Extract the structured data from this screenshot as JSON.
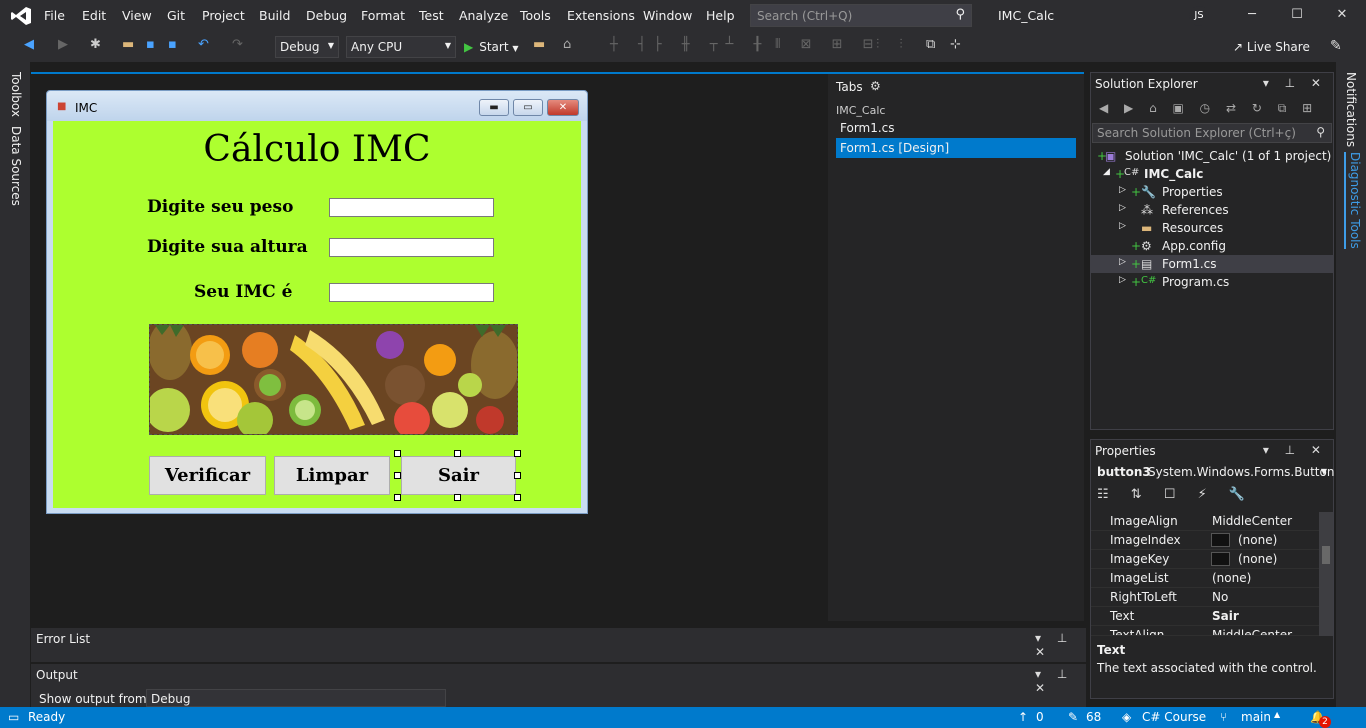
{
  "menu": {
    "items": [
      "File",
      "Edit",
      "View",
      "Git",
      "Project",
      "Build",
      "Debug",
      "Format",
      "Test",
      "Analyze",
      "Tools",
      "Extensions",
      "Window",
      "Help"
    ],
    "search_placeholder": "Search (Ctrl+Q)",
    "solution_title": "IMC_Calc",
    "user_initials": "JS"
  },
  "toolbar": {
    "config": "Debug",
    "platform": "Any CPU",
    "start_label": "Start",
    "live_share_label": "Live Share"
  },
  "left_rail": [
    "Toolbox",
    "Data Sources"
  ],
  "right_rail": [
    "Notifications",
    "Diagnostic Tools"
  ],
  "form": {
    "window_title": "IMC",
    "heading": "Cálculo IMC",
    "label_weight": "Digite seu peso",
    "label_height": "Digite sua altura",
    "label_result": "Seu IMC é",
    "btn_verify": "Verificar",
    "btn_clear": "Limpar",
    "btn_exit": "Sair",
    "background_color": "#adff2f"
  },
  "tabs_panel": {
    "title": "Tabs",
    "group": "IMC_Calc",
    "items": [
      "Form1.cs",
      "Form1.cs [Design]"
    ],
    "selected": "Form1.cs [Design]"
  },
  "solution_explorer": {
    "title": "Solution Explorer",
    "search_placeholder": "Search Solution Explorer (Ctrl+ç)",
    "solution": "Solution 'IMC_Calc' (1 of 1 project)",
    "project": "IMC_Calc",
    "nodes": [
      "Properties",
      "References",
      "Resources",
      "App.config",
      "Form1.cs",
      "Program.cs"
    ],
    "selected": "Form1.cs"
  },
  "properties": {
    "title": "Properties",
    "object_name": "button3",
    "object_type": "System.Windows.Forms.Button",
    "rows": [
      {
        "name": "ImageAlign",
        "value": "MiddleCenter"
      },
      {
        "name": "ImageIndex",
        "value": "(none)"
      },
      {
        "name": "ImageKey",
        "value": "(none)"
      },
      {
        "name": "ImageList",
        "value": "(none)"
      },
      {
        "name": "RightToLeft",
        "value": "No"
      },
      {
        "name": "Text",
        "value": "Sair"
      },
      {
        "name": "TextAlign",
        "value": "MiddleCenter"
      }
    ],
    "desc_title": "Text",
    "desc_text": "The text associated with the control."
  },
  "bottom": {
    "error_list": "Error List",
    "output": "Output",
    "output_from_label": "Show output from:",
    "output_from_value": "Debug"
  },
  "status": {
    "ready": "Ready",
    "up_count": "0",
    "edit_count": "68",
    "repo": "C# Course",
    "branch": "main",
    "notifications": "2"
  }
}
